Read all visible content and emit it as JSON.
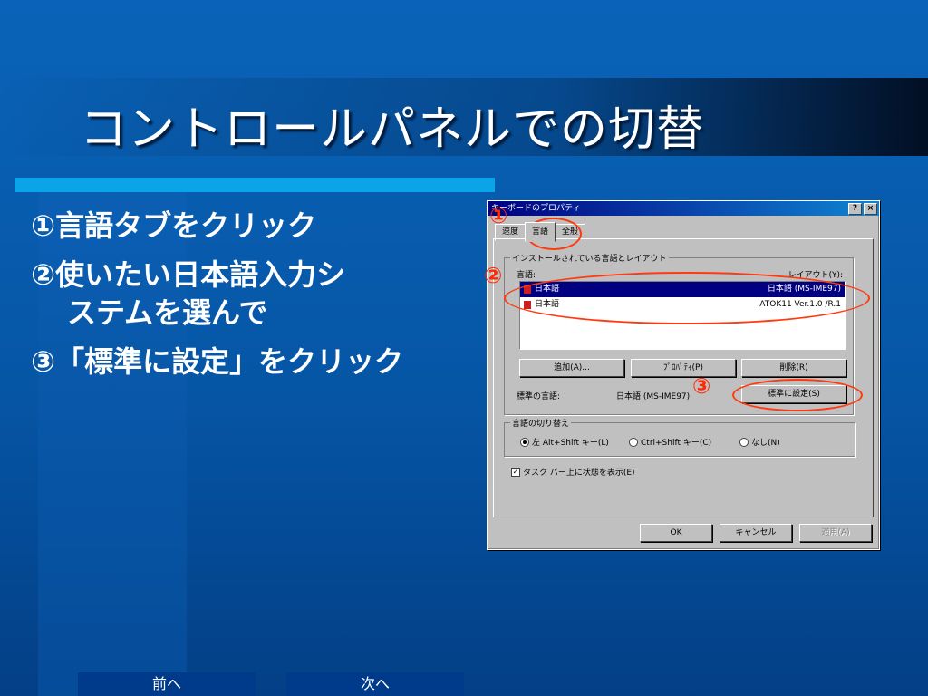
{
  "slide": {
    "title": "コントロールパネルでの切替",
    "steps": [
      {
        "num": "①",
        "text": "言語タブをクリック"
      },
      {
        "num": "②",
        "text": "使いたい日本語入力シ",
        "text2": "ステムを選んで"
      },
      {
        "num": "③",
        "text": "「標準に設定」をクリック"
      }
    ],
    "annotations": [
      "①",
      "②",
      "③"
    ]
  },
  "dialog": {
    "title": "キーボードのプロパティ",
    "help_btn": "?",
    "close_btn": "×",
    "tabs": [
      "速度",
      "言語",
      "全般"
    ],
    "group_installed": "インストールされている言語とレイアウト",
    "col_language": "言語:",
    "col_layout": "レイアウト(Y):",
    "languages": [
      {
        "name": "日本語",
        "layout": "日本語 (MS-IME97)"
      },
      {
        "name": "日本語",
        "layout": "ATOK11 Ver.1.0 /R.1"
      }
    ],
    "btn_add": "追加(A)...",
    "btn_props": "ﾌﾟﾛﾊﾟﾃｨ(P)",
    "btn_delete": "削除(R)",
    "default_label": "標準の言語:",
    "default_value": "日本語 (MS-IME97)",
    "btn_set_default": "標準に設定(S)",
    "group_switch": "言語の切り替え",
    "radio_left": "左 Alt+Shift キー(L)",
    "radio_ctrl": "Ctrl+Shift キー(C)",
    "radio_none": "なし(N)",
    "checkbox_taskbar": "タスク バー上に状態を表示(E)",
    "btn_ok": "OK",
    "btn_cancel": "キャンセル",
    "btn_apply": "適用(A)"
  },
  "nav": {
    "prev": "前へ",
    "next": "次へ"
  }
}
